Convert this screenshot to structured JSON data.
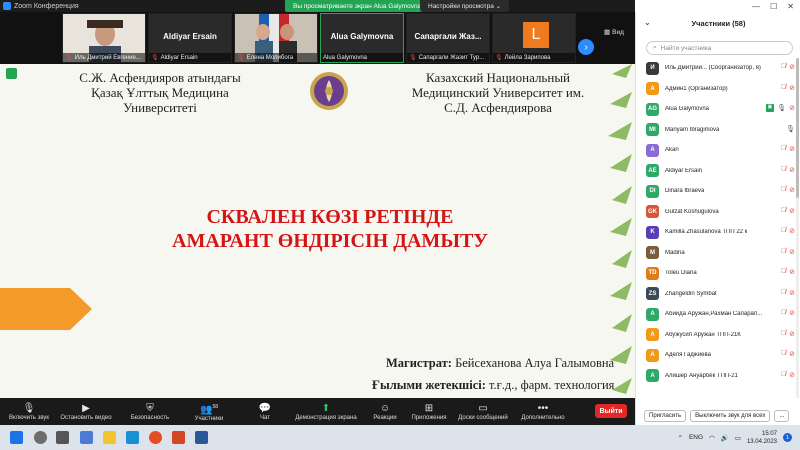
{
  "window": {
    "title": "Zoom Конференция",
    "share_banner": "Вы просматриваете экран Alua Galymovna",
    "view_options": "Настройки просмотра"
  },
  "thumbnails": [
    {
      "name": "Иль Дмитрий Евгение...",
      "big_name": "",
      "muted": true
    },
    {
      "name": "Aldiyar Ersain",
      "big_name": "Aldiyar Ersain",
      "muted": true
    },
    {
      "name": "Елена Молибога",
      "big_name": "",
      "muted": true
    },
    {
      "name": "Alua Galymovna",
      "big_name": "Alua Galymovna",
      "muted": false
    },
    {
      "name": "Сапаргали Жазит Тур...",
      "big_name": "Сапаргали Жаз...",
      "muted": true
    },
    {
      "name": "Лейла Зарипова",
      "big_name": "",
      "letter": "L",
      "muted": true
    }
  ],
  "view_label": "Вид",
  "slide": {
    "uni_left": [
      "С.Ж. Асфендияров атындағы",
      "Қазақ Ұлттық Медицина",
      "Университеті"
    ],
    "uni_right": [
      "Казахский Национальный",
      "Медицинский Университет им.",
      "С.Д. Асфендиярова"
    ],
    "title_lines": [
      "СКВАЛЕН КӨЗІ РЕТІНДЕ",
      "АМАРАНТ ӨНДІРІСІН ДАМЫТУ"
    ],
    "master_label": "Магистрат:",
    "master_name": "Бейсеханова Алуа Галымовна",
    "supervisor_label": "Ғылыми жетекшісі:",
    "supervisor_value": "т.ғ.д., фарм. технология"
  },
  "toolbar": {
    "items": [
      {
        "label": "Включить звук",
        "icon": "mic-muted-icon"
      },
      {
        "label": "Остановить видео",
        "icon": "video-icon"
      },
      {
        "label": "Безопасность",
        "icon": "shield-icon"
      },
      {
        "label": "Участники",
        "icon": "participants-icon",
        "count": "58"
      },
      {
        "label": "Чат",
        "icon": "chat-icon"
      },
      {
        "label": "Демонстрация экрана",
        "icon": "share-screen-icon"
      },
      {
        "label": "Реакции",
        "icon": "reactions-icon"
      },
      {
        "label": "Приложения",
        "icon": "apps-icon"
      },
      {
        "label": "Доски сообщений",
        "icon": "whiteboard-icon"
      },
      {
        "label": "Дополнительно",
        "icon": "more-icon"
      }
    ],
    "leave": "Выйти"
  },
  "panel": {
    "title": "Участники (58)",
    "search_placeholder": "Найти участника",
    "participants": [
      {
        "initials": "И",
        "color": "#3a3a3a",
        "name": "Иль Дмитрий... (Соорганизатор, я)",
        "mic": "off",
        "cam": "off"
      },
      {
        "initials": "А",
        "color": "#f09a1a",
        "name": "Админ1 (Организатор)",
        "mic": "off",
        "cam": "off"
      },
      {
        "initials": "AG",
        "color": "#2fa86a",
        "name": "Alua Galymovna",
        "mic": "on",
        "cam": "off",
        "sharing": true
      },
      {
        "initials": "MI",
        "color": "#2fa86a",
        "name": "Mariyam Ibragimova",
        "mic": "on",
        "cam": "none"
      },
      {
        "initials": "A",
        "color": "#8b6bd6",
        "name": "Akan",
        "mic": "off",
        "cam": "off"
      },
      {
        "initials": "AE",
        "color": "#2fa86a",
        "name": "Aldiyar Ersain",
        "mic": "off",
        "cam": "off"
      },
      {
        "initials": "DI",
        "color": "#2fa86a",
        "name": "Dinara Ibraeva",
        "mic": "off",
        "cam": "off"
      },
      {
        "initials": "GK",
        "color": "#d6563b",
        "name": "Gulzat Koshugulova",
        "mic": "off",
        "cam": "off"
      },
      {
        "initials": "K",
        "color": "#5a3fb3",
        "name": "Kamilla Zhasulanova ТПП 22 к",
        "mic": "off",
        "cam": "off"
      },
      {
        "initials": "M",
        "color": "#7a5c3e",
        "name": "Madina",
        "mic": "off",
        "cam": "off"
      },
      {
        "initials": "TD",
        "color": "#e07d1a",
        "name": "Toleu Diana",
        "mic": "off",
        "cam": "off"
      },
      {
        "initials": "ZS",
        "color": "#3a4a5a",
        "name": "Zhangeldin Symbat",
        "mic": "off",
        "cam": "off"
      },
      {
        "initials": "А",
        "color": "#2fa86a",
        "name": "Абиида Аружан,Рахман Сапарап...",
        "mic": "off",
        "cam": "off"
      },
      {
        "initials": "А",
        "color": "#f09a1a",
        "name": "Абужусип Аружан ТПП-21К",
        "mic": "off",
        "cam": "off"
      },
      {
        "initials": "А",
        "color": "#f09a1a",
        "name": "Аделя Гаджиева",
        "mic": "off",
        "cam": "off"
      },
      {
        "initials": "А",
        "color": "#2fa86a",
        "name": "Алишер Ануарбек ТПП-21",
        "mic": "off",
        "cam": "off"
      }
    ],
    "invite": "Пригласить",
    "mute_all": "Выключить звук для всех",
    "more": "..."
  },
  "taskbar": {
    "lang": "ENG",
    "time": "15:07",
    "date": "13.04.2023",
    "notifications": "1"
  }
}
